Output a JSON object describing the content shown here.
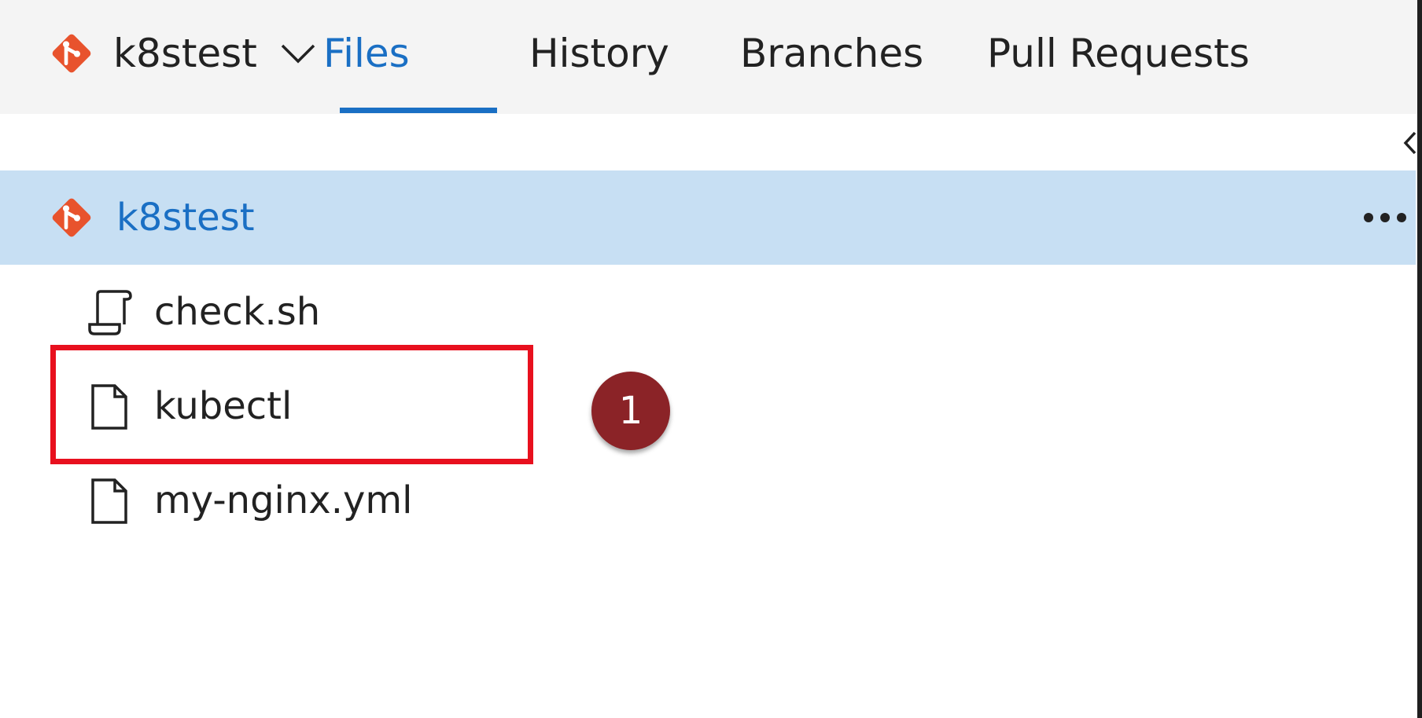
{
  "header": {
    "repo_name": "k8stest",
    "repo_icon": "git-diamond-icon",
    "tabs": [
      {
        "label": "Files",
        "active": true
      },
      {
        "label": "History",
        "active": false
      },
      {
        "label": "Branches",
        "active": false
      },
      {
        "label": "Pull Requests",
        "active": false
      }
    ]
  },
  "tree": {
    "root": {
      "label": "k8stest",
      "icon": "git-diamond-icon",
      "selected": true,
      "actions_icon": "more-horizontal-icon"
    },
    "files": [
      {
        "name": "check.sh",
        "icon": "script-file-icon"
      },
      {
        "name": "kubectl",
        "icon": "file-icon"
      },
      {
        "name": "my-nginx.yml",
        "icon": "file-icon"
      }
    ]
  },
  "annotation": {
    "step_number": "1",
    "highlight_color": "#e8101e",
    "badge_color": "#8b2327"
  },
  "colors": {
    "accent": "#1a6fc4",
    "selected_row": "#c7dff3",
    "git_icon": "#e8532d"
  }
}
